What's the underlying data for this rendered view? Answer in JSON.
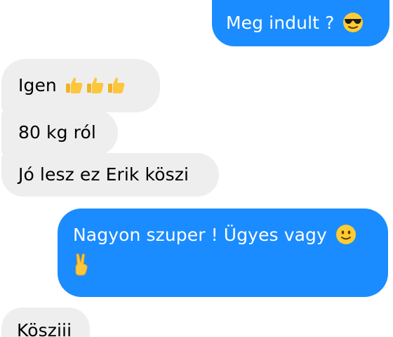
{
  "messages": [
    {
      "direction": "outgoing",
      "text": "Meg indult ?",
      "emoji": "smiling-face-with-sunglasses"
    },
    {
      "direction": "incoming",
      "text": "Igen",
      "emoji": "thumbs-up x3"
    },
    {
      "direction": "incoming",
      "text": "80 kg ról"
    },
    {
      "direction": "incoming",
      "text": "Jó lesz ez Erik köszi"
    },
    {
      "direction": "outgoing",
      "text": "Nagyon szuper ! Ügyes vagy",
      "emoji": "slightly-smiling-face, victory-hand"
    },
    {
      "direction": "incoming",
      "text": "Kösziii"
    }
  ],
  "colors": {
    "outgoing_bubble": "#1a8cff",
    "incoming_bubble": "#eeeeef",
    "outgoing_text": "#ffffff",
    "incoming_text": "#000000"
  }
}
